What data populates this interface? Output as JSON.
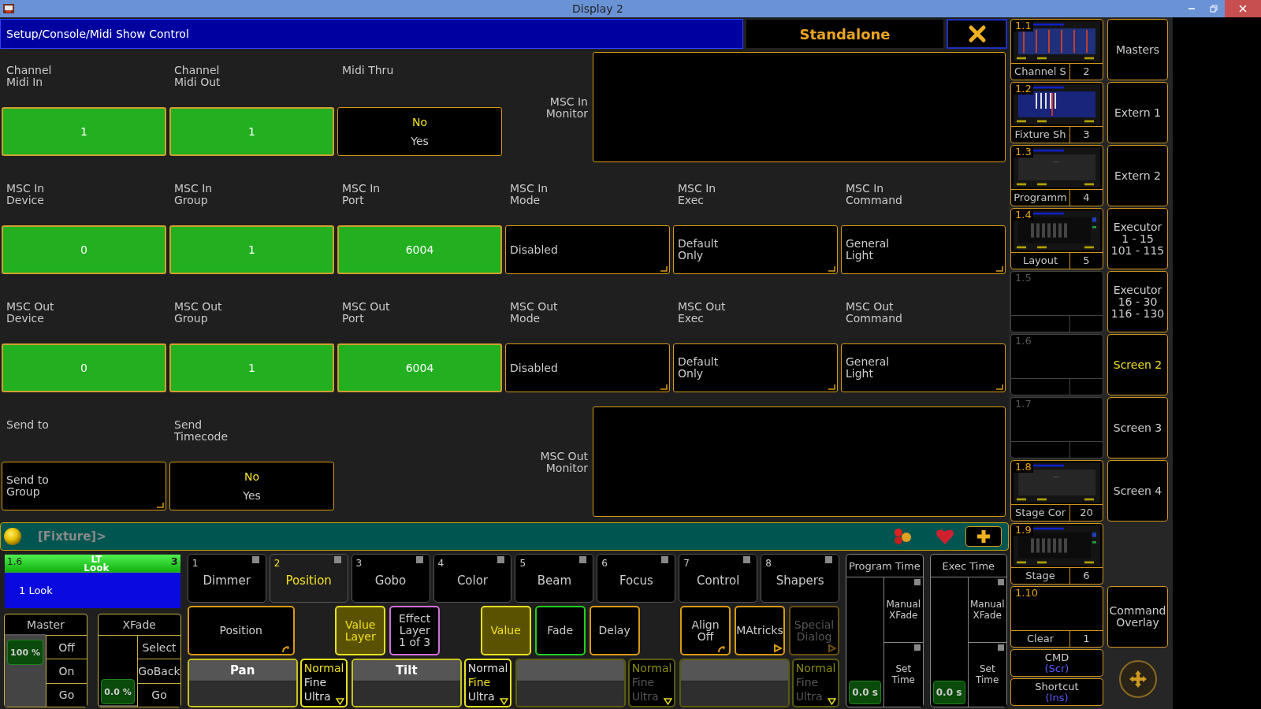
{
  "window": {
    "title": "Display 2"
  },
  "dialog": {
    "path": "Setup/Console/Midi Show Control",
    "mode": "Standalone"
  },
  "rows": [
    {
      "fields": [
        {
          "label": "Channel\nMidi In",
          "kind": "value",
          "value": "1"
        },
        {
          "label": "Channel\nMidi Out",
          "kind": "value",
          "value": "1"
        },
        {
          "label": "Midi Thru",
          "kind": "toggle",
          "options": [
            {
              "text": "No",
              "selected": true
            },
            {
              "text": "Yes",
              "selected": false
            }
          ]
        }
      ],
      "monitor": "MSC In\nMonitor"
    },
    {
      "fields": [
        {
          "label": "MSC In\nDevice",
          "kind": "value",
          "value": "0"
        },
        {
          "label": "MSC In\nGroup",
          "kind": "value",
          "value": "1"
        },
        {
          "label": "MSC In\nPort",
          "kind": "value",
          "value": "6004"
        },
        {
          "label": "MSC In\nMode",
          "kind": "select",
          "value": "Disabled"
        },
        {
          "label": "MSC In\nExec",
          "kind": "select",
          "value": "Default\nOnly"
        },
        {
          "label": "MSC In\nCommand",
          "kind": "select",
          "value": "General\nLight"
        }
      ]
    },
    {
      "fields": [
        {
          "label": "MSC Out\nDevice",
          "kind": "value",
          "value": "0"
        },
        {
          "label": "MSC Out\nGroup",
          "kind": "value",
          "value": "1"
        },
        {
          "label": "MSC Out\nPort",
          "kind": "value",
          "value": "6004"
        },
        {
          "label": "MSC Out\nMode",
          "kind": "select",
          "value": "Disabled"
        },
        {
          "label": "MSC Out\nExec",
          "kind": "select",
          "value": "Default\nOnly"
        },
        {
          "label": "MSC Out\nCommand",
          "kind": "select",
          "value": "General\nLight"
        }
      ]
    },
    {
      "fields": [
        {
          "label": "Send to",
          "kind": "select",
          "value": "Send to\nGroup"
        },
        {
          "label": "Send\nTimecode",
          "kind": "toggle",
          "options": [
            {
              "text": "No",
              "selected": true
            },
            {
              "text": "Yes",
              "selected": false
            }
          ]
        }
      ],
      "monitor": "MSC Out\nMonitor"
    }
  ],
  "command_line": {
    "prompt": "[Fixture]>"
  },
  "executor": {
    "number": "1.6",
    "name": "LT\nLook",
    "page": "3",
    "cue": "1 Look"
  },
  "faders": [
    {
      "title": "Master",
      "reading": "100 %",
      "level": 1,
      "buttons": [
        "Off",
        "On",
        "Go"
      ]
    },
    {
      "title": "XFade",
      "reading": "0.0 %",
      "level": 0,
      "buttons": [
        "Select",
        "GoBack",
        "Go"
      ]
    }
  ],
  "features": [
    {
      "number": "1",
      "label": "Dimmer",
      "selected": false
    },
    {
      "number": "2",
      "label": "Position",
      "selected": true
    },
    {
      "number": "3",
      "label": "Gobo",
      "selected": false
    },
    {
      "number": "4",
      "label": "Color",
      "selected": false
    },
    {
      "number": "5",
      "label": "Beam",
      "selected": false
    },
    {
      "number": "6",
      "label": "Focus",
      "selected": false
    },
    {
      "number": "7",
      "label": "Control",
      "selected": false
    },
    {
      "number": "8",
      "label": "Shapers",
      "selected": false
    }
  ],
  "function_groups": [
    {
      "buttons": [
        {
          "label": "Position",
          "color": "#d89a10",
          "selected": false,
          "disabled": false,
          "cycles": true,
          "opens_menu": false
        }
      ]
    },
    {
      "buttons": [
        {
          "label": "Value\nLayer",
          "color": "#e8e020",
          "selected": true,
          "disabled": false,
          "cycles": false,
          "opens_menu": false
        },
        {
          "label": "Effect\nLayer\n1 of 3",
          "color": "#d070d8",
          "selected": false,
          "disabled": false,
          "cycles": false,
          "opens_menu": false
        }
      ]
    },
    {
      "buttons": [
        {
          "label": "Value",
          "color": "#e8e020",
          "selected": true,
          "disabled": false,
          "cycles": false,
          "opens_menu": false
        },
        {
          "label": "Fade",
          "color": "#20d020",
          "selected": false,
          "disabled": false,
          "cycles": false,
          "opens_menu": false
        },
        {
          "label": "Delay",
          "color": "#d89a10",
          "selected": false,
          "disabled": false,
          "cycles": false,
          "opens_menu": false
        }
      ]
    },
    {
      "buttons": [
        {
          "label": "Align\nOff",
          "color": "#d89a10",
          "selected": false,
          "disabled": false,
          "cycles": true,
          "opens_menu": false
        },
        {
          "label": "MAtricks",
          "color": "#d89a10",
          "selected": false,
          "disabled": false,
          "cycles": false,
          "opens_menu": true
        },
        {
          "label": "Special\nDialog",
          "color": "#6a4e10",
          "selected": false,
          "disabled": true,
          "cycles": false,
          "opens_menu": true
        }
      ]
    }
  ],
  "encoders": [
    {
      "name": "Pan",
      "disabled": false,
      "resolutions": [
        {
          "text": "Normal",
          "selected": true
        },
        {
          "text": "Fine",
          "selected": false
        },
        {
          "text": "Ultra",
          "selected": false
        }
      ]
    },
    {
      "name": "Tilt",
      "disabled": false,
      "resolutions": [
        {
          "text": "Normal",
          "selected": false
        },
        {
          "text": "Fine",
          "selected": true
        },
        {
          "text": "Ultra",
          "selected": false
        }
      ]
    },
    {
      "disabled": true,
      "resolutions": [
        {
          "text": "Normal",
          "selected": true
        },
        {
          "text": "Fine",
          "selected": false
        },
        {
          "text": "Ultra",
          "selected": false
        }
      ]
    },
    {
      "disabled": true,
      "resolutions": [
        {
          "text": "Normal",
          "selected": true
        },
        {
          "text": "Fine",
          "selected": false
        },
        {
          "text": "Ultra",
          "selected": false
        }
      ]
    }
  ],
  "time_panels": [
    {
      "title": "Program Time",
      "reading": "0.0 s",
      "buttons": [
        "Manual\nXFade",
        "Set\nTime"
      ]
    },
    {
      "title": "Exec Time",
      "reading": "0.0 s",
      "buttons": [
        "Manual\nXFade",
        "Set\nTime"
      ]
    }
  ],
  "views": [
    {
      "number": "1.1",
      "kind": "picture",
      "name": "Channel S",
      "count": "2"
    },
    {
      "number": "1.2",
      "kind": "picture",
      "name": "Fixture Sh",
      "count": "3"
    },
    {
      "number": "1.3",
      "kind": "picture",
      "name": "Programm",
      "count": "4"
    },
    {
      "number": "1.4",
      "kind": "picture",
      "name": "Layout",
      "count": "5"
    },
    {
      "number": "1.5",
      "kind": "empty"
    },
    {
      "number": "1.6",
      "kind": "empty"
    },
    {
      "number": "1.7",
      "kind": "empty"
    },
    {
      "number": "1.8",
      "kind": "picture",
      "name": "Stage Cor",
      "count": "20"
    },
    {
      "number": "1.9",
      "kind": "picture",
      "name": "Stage",
      "count": "6"
    },
    {
      "number": "1.10",
      "kind": "blank",
      "name": "Clear",
      "count": "1"
    }
  ],
  "cmd_buttons": [
    {
      "label": "CMD",
      "key": "(Scr)"
    },
    {
      "label": "Shortcut",
      "key": "(Ins)"
    }
  ],
  "screen_buttons": [
    {
      "label": "Masters",
      "selected": false
    },
    {
      "label": "Extern 1",
      "selected": false
    },
    {
      "label": "Extern 2",
      "selected": false
    },
    {
      "label": "Executor\n1 - 15\n101 - 115",
      "selected": false
    },
    {
      "label": "Executor\n16 - 30\n116 - 130",
      "selected": false
    },
    {
      "label": "Screen 2",
      "selected": true
    },
    {
      "label": "Screen 3",
      "selected": false
    },
    {
      "label": "Screen 4",
      "selected": false
    },
    {
      "label": "Command\nOverlay",
      "selected": false
    }
  ]
}
